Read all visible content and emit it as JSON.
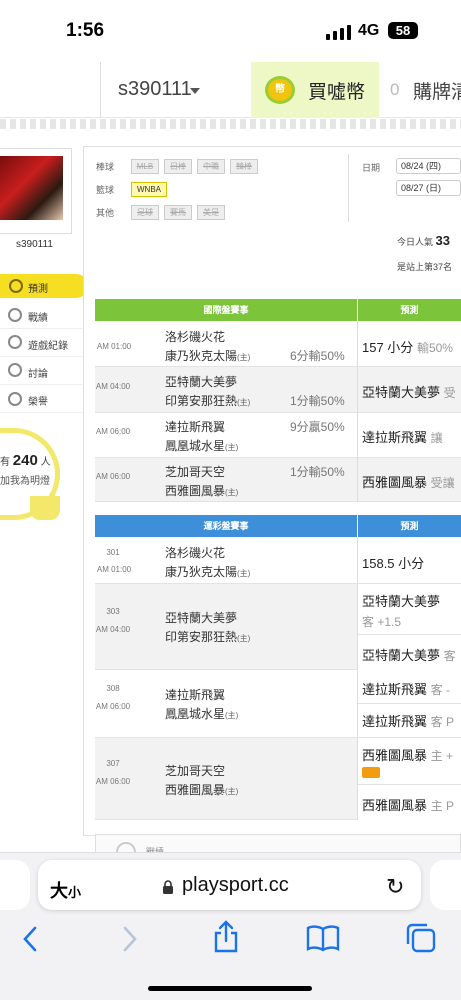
{
  "status_bar": {
    "time": "1:56",
    "network": "4G",
    "battery": "58"
  },
  "header": {
    "username": "s390111",
    "coin_icon_text": "幣",
    "coin_label": "買噓幣",
    "buy_count": "0",
    "buy_label": "購牌清"
  },
  "sidebar": {
    "username": "s390111",
    "predict_label": "預測",
    "menu": [
      "戰績",
      "遊戲紀錄",
      "討論",
      "榮譽"
    ],
    "bulb_prefix": "有",
    "bulb_count": "240",
    "bulb_suffix": "人",
    "bulb_sub": "加我為明燈"
  },
  "filters": {
    "row1_label": "棒球",
    "row1_tags": [
      "MLB",
      "日棒",
      "中職",
      "韓棒"
    ],
    "row2_label": "籃球",
    "row2_tags": [
      "WNBA"
    ],
    "row3_label": "其他",
    "row3_tags": [
      "足球",
      "賽馬",
      "美足"
    ],
    "date_label": "日期",
    "dates": [
      "08/24 (四)",
      "08/27 (日)"
    ]
  },
  "stats": {
    "today_label": "今日人氣",
    "today_value": "33",
    "rank": "是站上第37名"
  },
  "intl_table": {
    "title": "國際盤賽事",
    "pred_title": "預測",
    "rows": [
      {
        "time": "AM 01:00",
        "team1": "洛杉磯火花",
        "team2": "康乃狄克太陽",
        "host": "(主)",
        "odds": "6分輸50%",
        "pick": "157 小分",
        "pick_note": "輸50%"
      },
      {
        "time": "AM 04:00",
        "team1": "亞特蘭大美夢",
        "team2": "印第安那狂熱",
        "host": "(主)",
        "odds": "1分輸50%",
        "pick": "亞特蘭大美夢",
        "pick_note": "受"
      },
      {
        "time": "AM 06:00",
        "team1": "達拉斯飛翼",
        "team2": "鳳凰城水星",
        "host": "(主)",
        "odds": "9分贏50%",
        "pick": "達拉斯飛翼",
        "pick_note": "讓"
      },
      {
        "time": "AM 06:00",
        "team1": "芝加哥天空",
        "team2": "西雅圖風暴",
        "host": "(主)",
        "odds": "1分輸50%",
        "pick": "西雅圖風暴",
        "pick_note": "受讓"
      }
    ]
  },
  "sport_table": {
    "title": "運彩盤賽事",
    "pred_title": "預測",
    "rows": [
      {
        "num": "301",
        "time": "AM 01:00",
        "team1": "洛杉磯火花",
        "team2": "康乃狄克太陽",
        "host": "(主)",
        "pick1": "158.5 小分",
        "note1": "",
        "pick2": "",
        "note2": ""
      },
      {
        "num": "303",
        "time": "AM 04:00",
        "team1": "亞特蘭大美夢",
        "team2": "印第安那狂熱",
        "host": "(主)",
        "pick1": "亞特蘭大美夢",
        "note1": "客 +1.5",
        "pick2": "亞特蘭大美夢",
        "note2": "客"
      },
      {
        "num": "308",
        "time": "AM 06:00",
        "team1": "達拉斯飛翼",
        "team2": "鳳凰城水星",
        "host": "(主)",
        "pick1": "達拉斯飛翼",
        "note1": "客 -",
        "pick2": "達拉斯飛翼",
        "note2": "客 P"
      },
      {
        "num": "307",
        "time": "AM 06:00",
        "team1": "芝加哥天空",
        "team2": "西雅圖風暴",
        "host": "(主)",
        "pick1": "西雅圖風暴",
        "note1": "主 +",
        "pick2": "西雅圖風暴",
        "note2": "主 P"
      }
    ]
  },
  "bottom_card": {
    "label": "戰績"
  },
  "browser": {
    "text_size": "大",
    "text_size_small": "小",
    "url": "playsport.cc"
  }
}
